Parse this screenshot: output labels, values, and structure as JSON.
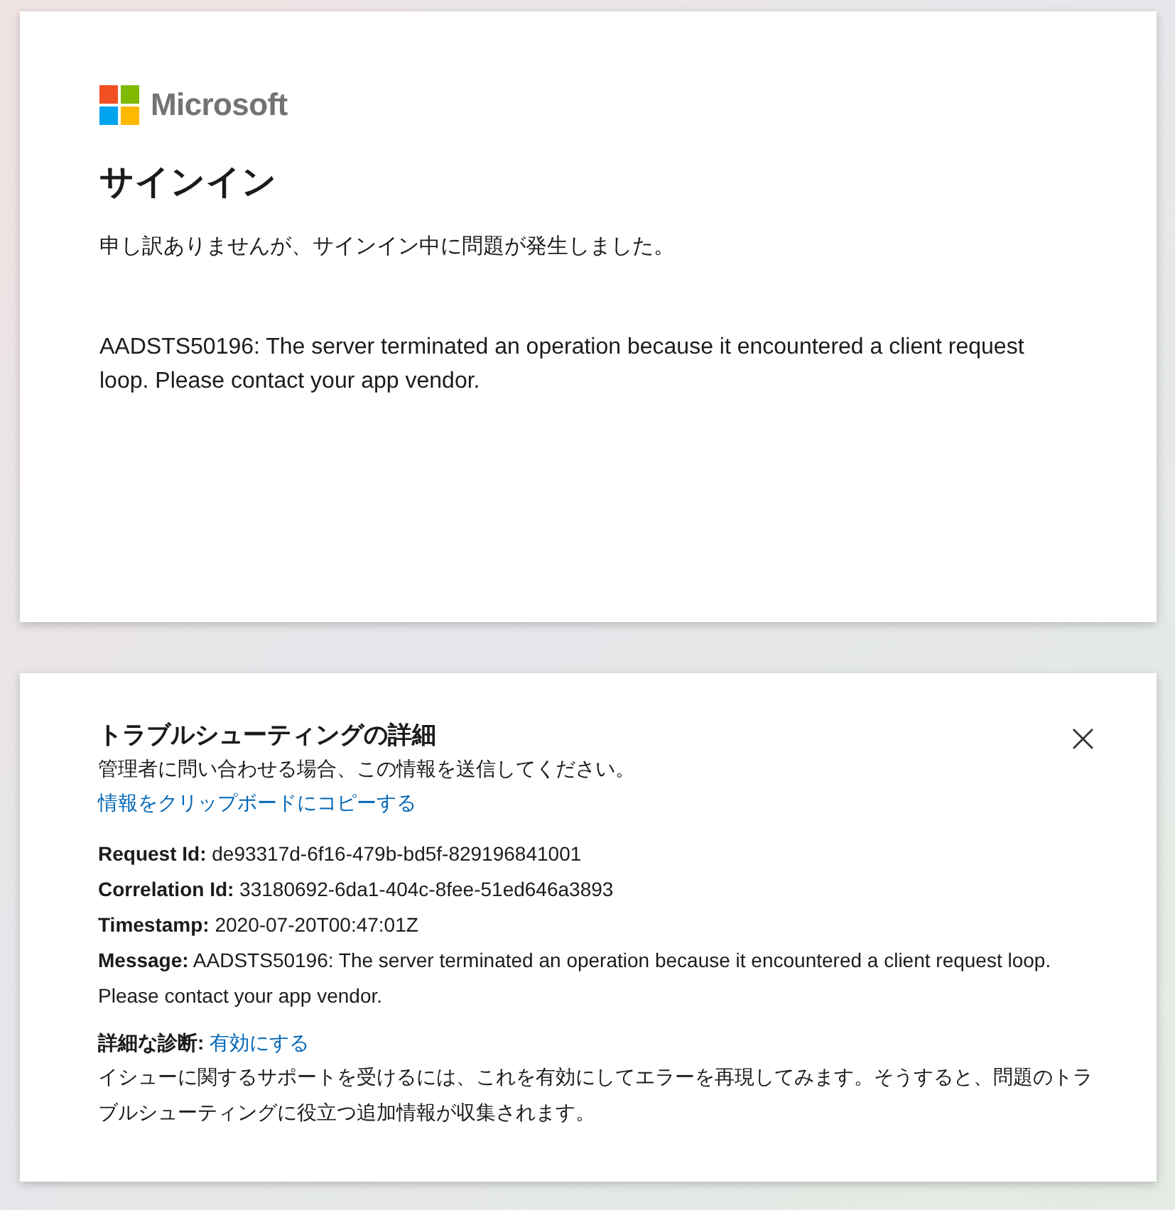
{
  "signin_card": {
    "brand": "Microsoft",
    "title": "サインイン",
    "message": "申し訳ありませんが、サインイン中に問題が発生しました。",
    "error": "AADSTS50196: The server terminated an operation because it encountered a client request loop. Please contact your app vendor."
  },
  "troubleshooting": {
    "title": "トラブルシューティングの詳細",
    "close": "×",
    "intro": "管理者に問い合わせる場合、この情報を送信してください。",
    "copy_link": "情報をクリップボードにコピーする",
    "details": [
      "**Request Id:** de93317d-6f16-479b-bd5f-829196841001",
      "**Correlation Id:** 33180692-6da1-404c-8fee-51ed646a3893",
      "**Timestamp:** 2020-07-20T00:47:01Z",
      "**Message:** AADSTS50196: The server terminated an operation because it encountered a client request loop. Please contact your app vendor."
    ],
    "diagnostics": {
      "label": "詳細な診断:",
      "link": "有効にする",
      "description": "イシューに関するサポートを受けるには、これを有効にしてエラーを再現してみます。そうすると、問題のトラブルシューティングに役立つ追加情報が収集されます。"
    }
  }
}
